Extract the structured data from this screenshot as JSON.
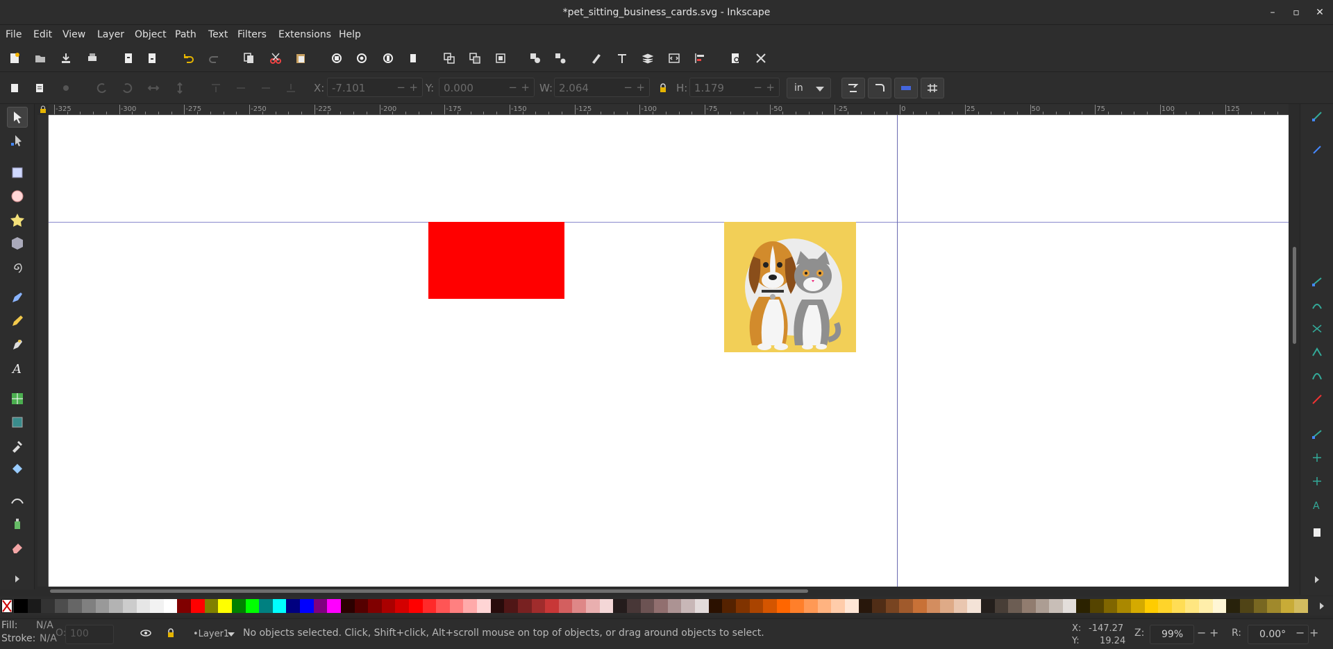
{
  "window": {
    "title": "*pet_sitting_business_cards.svg - Inkscape",
    "minimize_icon": "minimize-icon",
    "maximize_icon": "maximize-icon",
    "close_icon": "close-icon"
  },
  "menu": [
    "File",
    "Edit",
    "View",
    "Layer",
    "Object",
    "Path",
    "Text",
    "Filters",
    "Extensions",
    "Help"
  ],
  "commands": [
    "new-document-icon",
    "open-document-icon",
    "save-icon",
    "print-icon",
    "import-icon",
    "export-icon",
    "undo-icon",
    "redo-icon",
    "copy-icon",
    "cut-icon",
    "paste-icon",
    "zoom-selection-icon",
    "zoom-drawing-icon",
    "zoom-page-icon",
    "zoom-width-icon",
    "duplicate-icon",
    "clone-icon",
    "unlink-clone-icon",
    "group-icon",
    "ungroup-icon",
    "fill-stroke-icon",
    "text-font-icon",
    "layers-icon",
    "xml-editor-icon",
    "align-distribute-icon",
    "document-properties-icon",
    "preferences-icon"
  ],
  "controls": {
    "x": {
      "label": "X:",
      "value": "-7.101"
    },
    "y": {
      "label": "Y:",
      "value": "0.000"
    },
    "w": {
      "label": "W:",
      "value": "2.064"
    },
    "h": {
      "label": "H:",
      "value": "1.179"
    },
    "unit": "in",
    "minus": "−",
    "plus": "+"
  },
  "ruler": {
    "ticks": [
      "-325",
      "-300",
      "-275",
      "-250",
      "-225",
      "-200",
      "-175",
      "-150",
      "-125",
      "-100",
      "-75",
      "-50",
      "-25",
      "0",
      "25",
      "50",
      "75",
      "100",
      "125"
    ]
  },
  "tools": [
    "selector-tool-icon",
    "node-tool-icon",
    "rectangle-tool-icon",
    "ellipse-tool-icon",
    "star-tool-icon",
    "3d-box-tool-icon",
    "spiral-tool-icon",
    "pen-tool-icon",
    "pencil-tool-icon",
    "calligraphy-tool-icon",
    "text-tool-icon",
    "mesh-tool-icon",
    "gradient-tool-icon",
    "dropper-tool-icon",
    "paint-bucket-tool-icon",
    "tweak-tool-icon",
    "spray-tool-icon",
    "eraser-tool-icon",
    "expand-toolbox-icon"
  ],
  "canvas_objects": {
    "red_rect_color": "#ff0000",
    "pet_image": "dog-and-cat-illustration",
    "pet_bg_color": "#f2cf57"
  },
  "palette": {
    "colors": [
      "#000000",
      "#1a1a1a",
      "#333333",
      "#4d4d4d",
      "#666666",
      "#808080",
      "#999999",
      "#b3b3b3",
      "#cccccc",
      "#e6e6e6",
      "#f2f2f2",
      "#ffffff",
      "#800000",
      "#ff0000",
      "#808000",
      "#ffff00",
      "#008000",
      "#00ff00",
      "#008080",
      "#00ffff",
      "#000080",
      "#0000ff",
      "#800080",
      "#ff00ff",
      "#2b0000",
      "#550000",
      "#800000",
      "#aa0000",
      "#d40000",
      "#ff0000",
      "#ff2a2a",
      "#ff5555",
      "#ff8080",
      "#ffaaaa",
      "#ffd5d5",
      "#280b0b",
      "#501616",
      "#782121",
      "#a02c2c",
      "#c83737",
      "#d35f5f",
      "#de8787",
      "#e9afaf",
      "#f4d7d7",
      "#241c1c",
      "#483737",
      "#6c5353",
      "#916f6f",
      "#ac9393",
      "#c8b7b7",
      "#e3dbdb",
      "#2b1100",
      "#552200",
      "#803300",
      "#aa4400",
      "#d45500",
      "#ff6600",
      "#ff7f2a",
      "#ff9955",
      "#ffb380",
      "#ffccaa",
      "#ffe6d5",
      "#28170b",
      "#502d16",
      "#784421",
      "#a05a2c",
      "#c87137",
      "#d38d5f",
      "#deaa87",
      "#e9c6af",
      "#f4e3d7",
      "#241f1c",
      "#483e37",
      "#6c5d53",
      "#917c6f",
      "#ac9d93",
      "#c8beb7",
      "#e3dedb",
      "#2b2200",
      "#554400",
      "#806600",
      "#aa8800",
      "#d4aa00",
      "#ffcc00",
      "#ffd42a",
      "#ffdd55",
      "#ffe680",
      "#ffeeaa",
      "#fff6d5",
      "#28220b",
      "#504416",
      "#786721",
      "#a0892c",
      "#c8ab37",
      "#d3bc5f"
    ]
  },
  "status": {
    "fill_label": "Fill:",
    "fill_value": "N/A",
    "stroke_label": "Stroke:",
    "stroke_value": "N/A",
    "opacity_label": "O:",
    "opacity_value": "100",
    "layer": "•Layer1",
    "message": "No objects selected. Click, Shift+click, Alt+scroll mouse on top of objects, or drag around objects to select.",
    "x_label": "X:",
    "x_value": "-147.27",
    "y_label": "Y:",
    "y_value": "19.24",
    "zoom_label": "Z:",
    "zoom_value": "99%",
    "rotate_label": "R:",
    "rotate_value": "0.00°"
  }
}
